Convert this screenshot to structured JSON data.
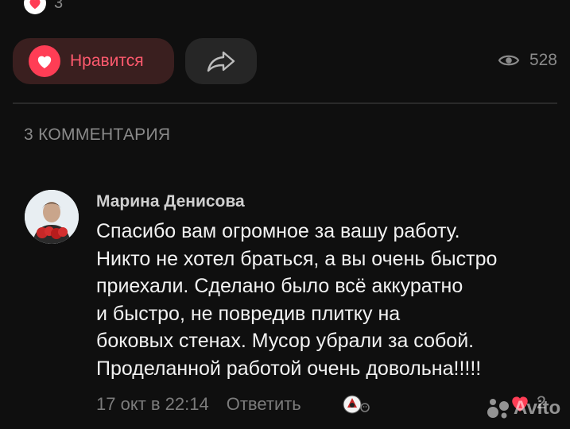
{
  "reactions_top": {
    "count": "3"
  },
  "actions": {
    "like_label": "Нравится",
    "views_count": "528"
  },
  "comments": {
    "header": "3 КОММЕНТАРИЯ",
    "items": [
      {
        "author": "Марина Денисова",
        "lines": [
          "Спасибо вам огромное за вашу работу.",
          "Никто не хотел браться, а вы очень быстро",
          "приехали. Сделано было всё аккуратно",
          "и быстро, не повредив плитку на",
          "боковых стенах. Мусор убрали за собой.",
          "Проделанной работой очень довольна!!!!!"
        ],
        "timestamp": "17 окт в 22:14",
        "reply_label": "Ответить",
        "likes": "2"
      }
    ]
  },
  "watermark": {
    "text": "Avito"
  },
  "colors": {
    "background": "#0f0f0f",
    "like_accent": "#ff3d55",
    "like_button_bg": "#3a1f1f",
    "muted_text": "#8a8a8a"
  },
  "icons": [
    "heart-icon",
    "share-arrow-icon",
    "eye-icon",
    "emoji-react-icon"
  ]
}
